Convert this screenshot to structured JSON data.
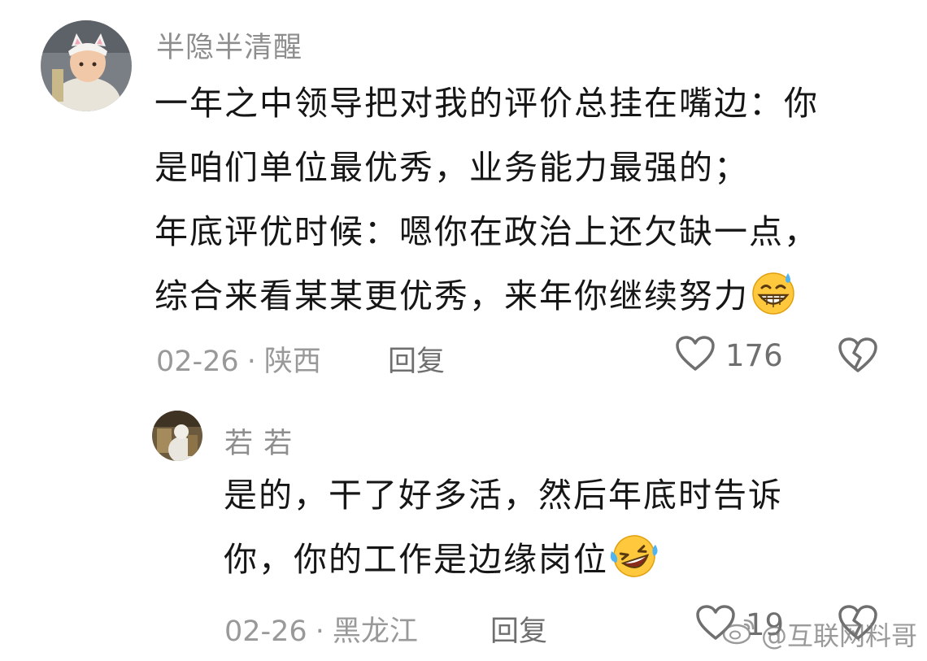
{
  "comments": [
    {
      "username": "半隐半清醒",
      "lines": [
        "一年之中领导把对我的评价总挂在嘴边：你",
        "是咱们单位最优秀，业务能力最强的；",
        "年底评优时候：嗯你在政治上还欠缺一点，",
        "综合来看某某更优秀，来年你继续努力"
      ],
      "emoji": "grinning-sweat-emoji",
      "date": "02-26",
      "separator": "·",
      "location": "陕西",
      "reply_label": "回复",
      "likes": "176"
    },
    {
      "username": "若 若",
      "lines": [
        "是的，干了好多活，然后年底时告诉",
        "你，你的工作是边缘岗位"
      ],
      "emoji": "rolling-laughing-emoji",
      "date": "02-26",
      "separator": "·",
      "location": "黑龙江",
      "reply_label": "回复",
      "likes": "19"
    }
  ],
  "watermark": "@互联网料哥",
  "colors": {
    "text": "#161616",
    "meta": "#999999",
    "icon": "#6f6f6f",
    "emoji_yellow": "#ffc83d"
  }
}
